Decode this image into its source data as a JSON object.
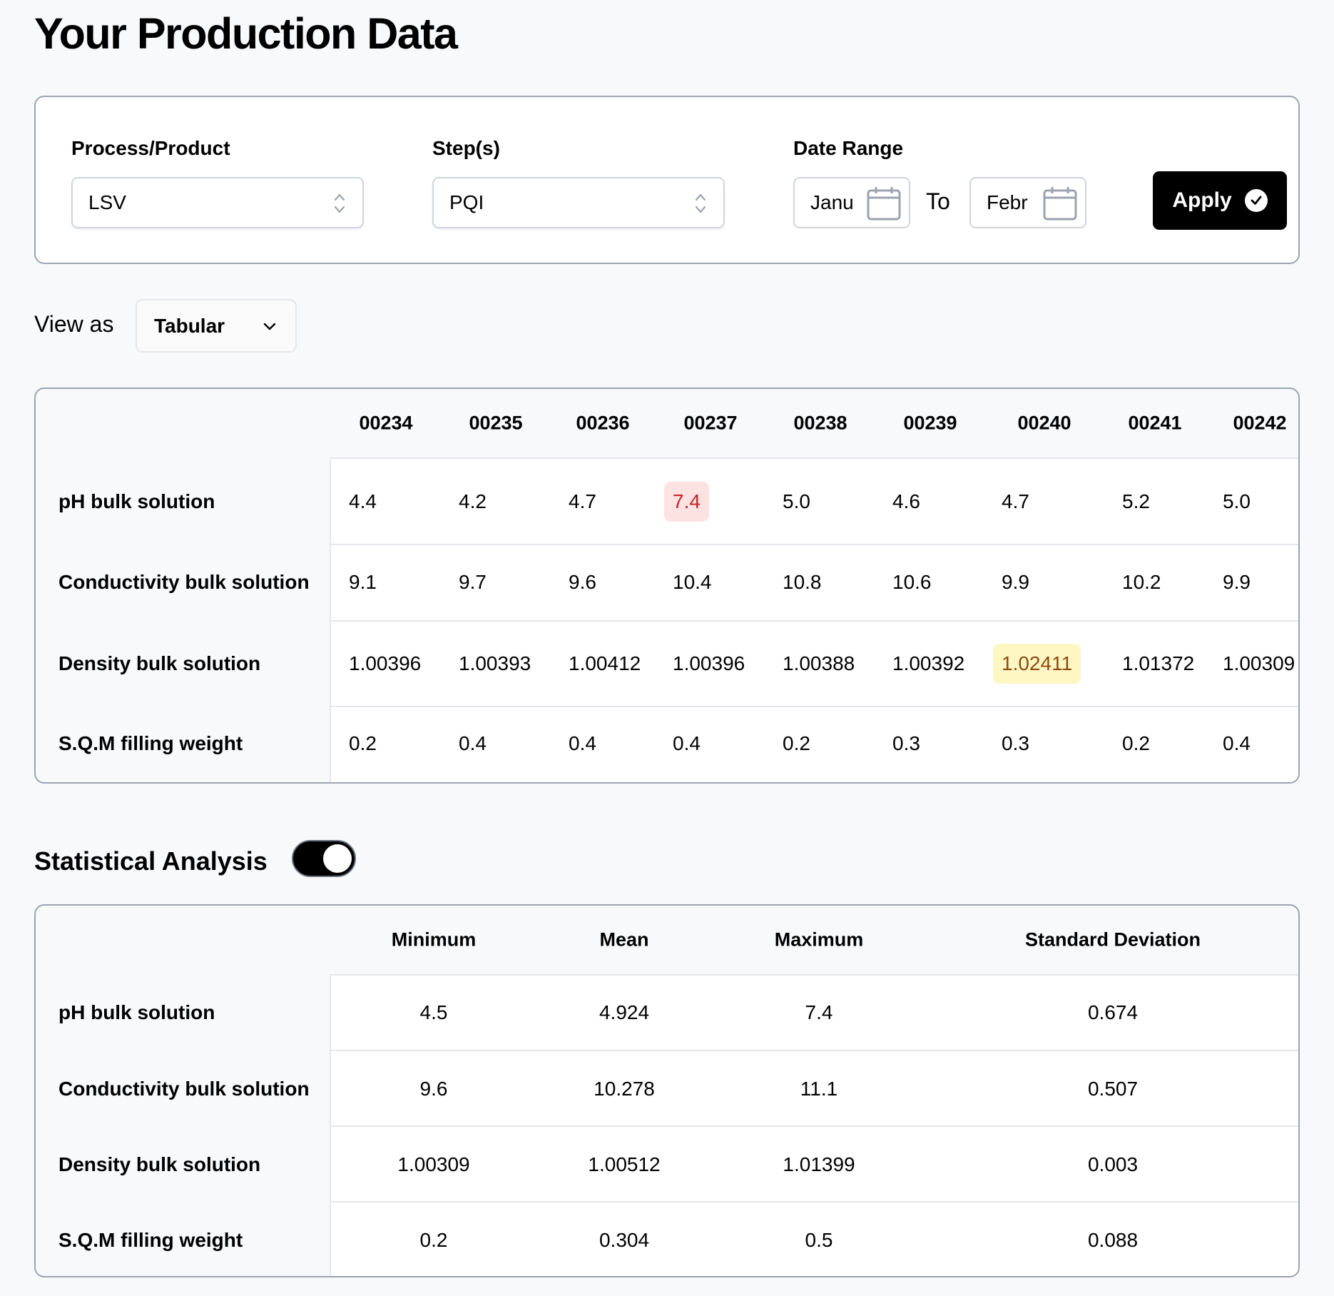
{
  "page": {
    "title": "Your Production Data"
  },
  "filters": {
    "process_label": "Process/Product",
    "process_value": "LSV",
    "steps_label": "Step(s)",
    "steps_value": "PQI",
    "date_label": "Date Range",
    "date_from": "Janu",
    "date_to_label": "To",
    "date_to": "Febr",
    "apply_label": "Apply"
  },
  "view": {
    "label": "View as",
    "value": "Tabular"
  },
  "data_table": {
    "columns": [
      "00234",
      "00235",
      "00236",
      "00237",
      "00238",
      "00239",
      "00240",
      "00241",
      "00242"
    ],
    "rows": [
      {
        "label": "pH bulk solution",
        "values": [
          "4.4",
          "4.2",
          "4.7",
          "7.4",
          "5.0",
          "4.6",
          "4.7",
          "5.2",
          "5.0"
        ],
        "flags": {
          "3": "high"
        }
      },
      {
        "label": "Conductivity bulk solution",
        "values": [
          "9.1",
          "9.7",
          "9.6",
          "10.4",
          "10.8",
          "10.6",
          "9.9",
          "10.2",
          "9.9"
        ],
        "flags": {}
      },
      {
        "label": "Density bulk solution",
        "values": [
          "1.00396",
          "1.00393",
          "1.00412",
          "1.00396",
          "1.00388",
          "1.00392",
          "1.02411",
          "1.01372",
          "1.00309"
        ],
        "flags": {
          "6": "warn"
        }
      },
      {
        "label": "S.Q.M filling weight",
        "values": [
          "0.2",
          "0.4",
          "0.4",
          "0.4",
          "0.2",
          "0.3",
          "0.3",
          "0.2",
          "0.4"
        ],
        "flags": {}
      }
    ],
    "flag_colors": {
      "high_bg": "#fde2e2",
      "high_text": "#c0262d",
      "warn_bg": "#fef7c3",
      "warn_text": "#8a4b0f"
    }
  },
  "stats": {
    "title": "Statistical Analysis",
    "toggle_on": true,
    "columns": [
      "Minimum",
      "Mean",
      "Maximum",
      "Standard Deviation"
    ],
    "rows": [
      {
        "label": "pH bulk solution",
        "values": [
          "4.5",
          "4.924",
          "7.4",
          "0.674"
        ]
      },
      {
        "label": "Conductivity bulk solution",
        "values": [
          "9.6",
          "10.278",
          "11.1",
          "0.507"
        ]
      },
      {
        "label": "Density bulk solution",
        "values": [
          "1.00309",
          "1.00512",
          "1.01399",
          "0.003"
        ]
      },
      {
        "label": "S.Q.M filling weight",
        "values": [
          "0.2",
          "0.304",
          "0.5",
          "0.088"
        ]
      }
    ]
  }
}
